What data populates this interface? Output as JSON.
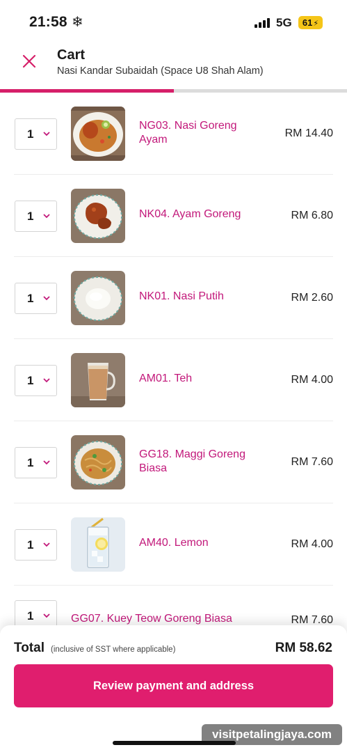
{
  "status_bar": {
    "time": "21:58",
    "weather_icon": "snowflake-icon",
    "network": "5G",
    "battery": "61"
  },
  "header": {
    "title": "Cart",
    "subtitle": "Nasi Kandar Subaidah (Space U8 Shah Alam)"
  },
  "progress": {
    "fraction": 0.5
  },
  "items": [
    {
      "qty": "1",
      "name": "NG03. Nasi Goreng Ayam",
      "price": "RM 14.40",
      "image": "fried-rice-with-chicken-photo"
    },
    {
      "qty": "1",
      "name": "NK04. Ayam Goreng",
      "price": "RM 6.80",
      "image": "fried-chicken-photo"
    },
    {
      "qty": "1",
      "name": "NK01. Nasi Putih",
      "price": "RM 2.60",
      "image": "white-rice-photo"
    },
    {
      "qty": "1",
      "name": "AM01. Teh",
      "price": "RM 4.00",
      "image": "milk-tea-photo"
    },
    {
      "qty": "1",
      "name": "GG18. Maggi Goreng Biasa",
      "price": "RM 7.60",
      "image": "fried-noodles-photo"
    },
    {
      "qty": "1",
      "name": "AM40. Lemon",
      "price": "RM 4.00",
      "image": "lemon-drink-photo"
    },
    {
      "qty": "1",
      "name": "GG07. Kuey Teow Goreng Biasa",
      "price": "RM 7.60"
    }
  ],
  "footer": {
    "total_label": "Total",
    "total_note": "(inclusive of SST where applicable)",
    "total_value": "RM 58.62",
    "cta_label": "Review payment and address"
  },
  "watermark": "visitpetalingjaya.com",
  "colors": {
    "accent": "#e01e6e",
    "item_name": "#c2187a",
    "progress": "#d61f69"
  }
}
